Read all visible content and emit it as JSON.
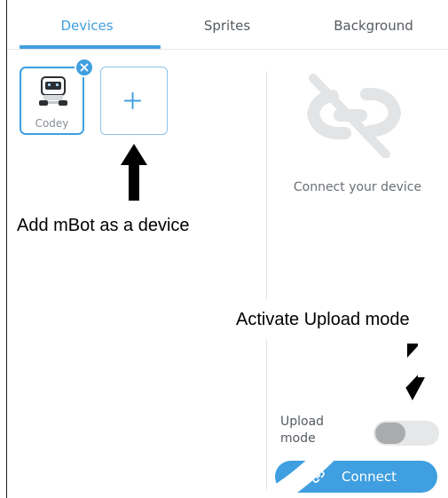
{
  "tabs": [
    {
      "label": "Devices",
      "active": true
    },
    {
      "label": "Sprites",
      "active": false
    },
    {
      "label": "Background",
      "active": false
    }
  ],
  "device": {
    "name": "Codey",
    "icon": "robot-icon",
    "remove_icon": "close-icon"
  },
  "add_device": {
    "icon": "plus-icon"
  },
  "connect_panel": {
    "icon": "disconnected-link-icon",
    "message": "Connect your device"
  },
  "annotations": {
    "add_device_note": "Add mBot as a device",
    "upload_mode_note": "Activate Upload mode"
  },
  "upload_mode": {
    "label": "Upload mode",
    "enabled": false
  },
  "connect_button": {
    "label": "Connect",
    "icon": "link-icon"
  },
  "colors": {
    "accent": "#3f9fe0",
    "muted_text": "#555a60",
    "toggle_track": "#e6e7e8"
  }
}
